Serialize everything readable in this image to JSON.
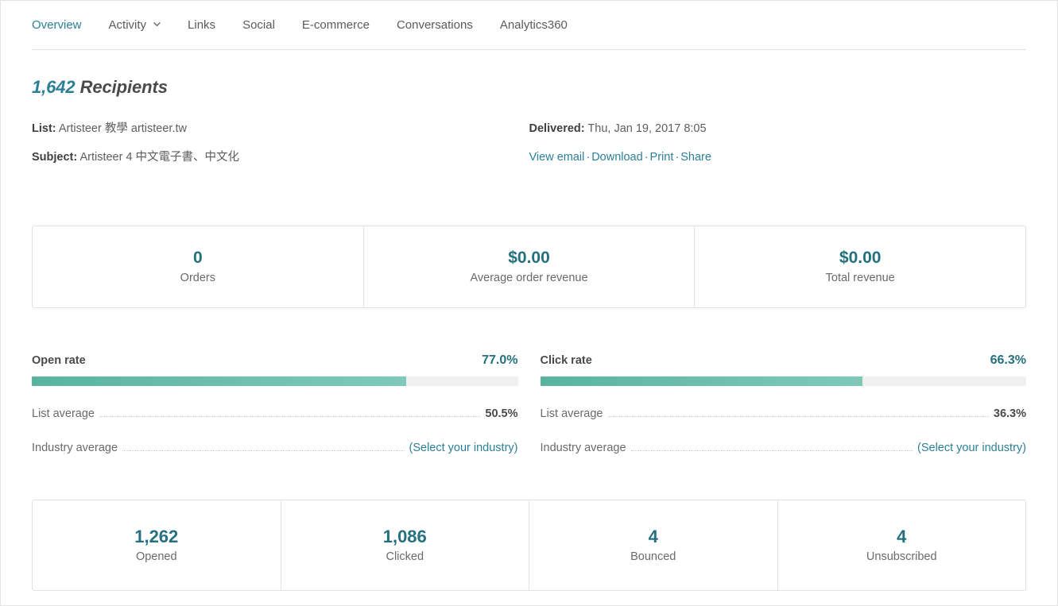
{
  "nav": {
    "items": [
      {
        "label": "Overview",
        "active": true,
        "dropdown": false
      },
      {
        "label": "Activity",
        "active": false,
        "dropdown": true
      },
      {
        "label": "Links",
        "active": false,
        "dropdown": false
      },
      {
        "label": "Social",
        "active": false,
        "dropdown": false
      },
      {
        "label": "E-commerce",
        "active": false,
        "dropdown": false
      },
      {
        "label": "Conversations",
        "active": false,
        "dropdown": false
      },
      {
        "label": "Analytics360",
        "active": false,
        "dropdown": false
      }
    ]
  },
  "summary": {
    "recipients_count": "1,642",
    "recipients_word": "Recipients",
    "list_label": "List:",
    "list_value": "Artisteer 教學 artisteer.tw",
    "subject_label": "Subject:",
    "subject_value": "Artisteer 4 中文電子書、中文化",
    "delivered_label": "Delivered:",
    "delivered_value": "Thu, Jan 19, 2017 8:05",
    "actions": [
      {
        "label": "View email"
      },
      {
        "label": "Download"
      },
      {
        "label": "Print"
      },
      {
        "label": "Share"
      }
    ],
    "action_separator": "·"
  },
  "ecommerce_cards": [
    {
      "value": "0",
      "label": "Orders"
    },
    {
      "value": "$0.00",
      "label": "Average order revenue"
    },
    {
      "value": "$0.00",
      "label": "Total revenue"
    }
  ],
  "rates": [
    {
      "name": "Open rate",
      "percent": "77.0%",
      "percent_value": 77.0,
      "list_average_label": "List average",
      "list_average_value": "50.5%",
      "industry_average_label": "Industry average",
      "industry_average_value": "(Select your industry)"
    },
    {
      "name": "Click rate",
      "percent": "66.3%",
      "percent_value": 66.3,
      "list_average_label": "List average",
      "list_average_value": "36.3%",
      "industry_average_label": "Industry average",
      "industry_average_value": "(Select your industry)"
    }
  ],
  "engagement_cards": [
    {
      "value": "1,262",
      "label": "Opened"
    },
    {
      "value": "1,086",
      "label": "Clicked"
    },
    {
      "value": "4",
      "label": "Bounced"
    },
    {
      "value": "4",
      "label": "Unsubscribed"
    }
  ],
  "colors": {
    "accent_link": "#2d7f98",
    "stat_value": "#24707f",
    "bar_fill_start": "#58b49f",
    "bar_fill_end": "#80c9b8",
    "bar_track": "#f0f0f0",
    "border": "#e2e2e2"
  }
}
